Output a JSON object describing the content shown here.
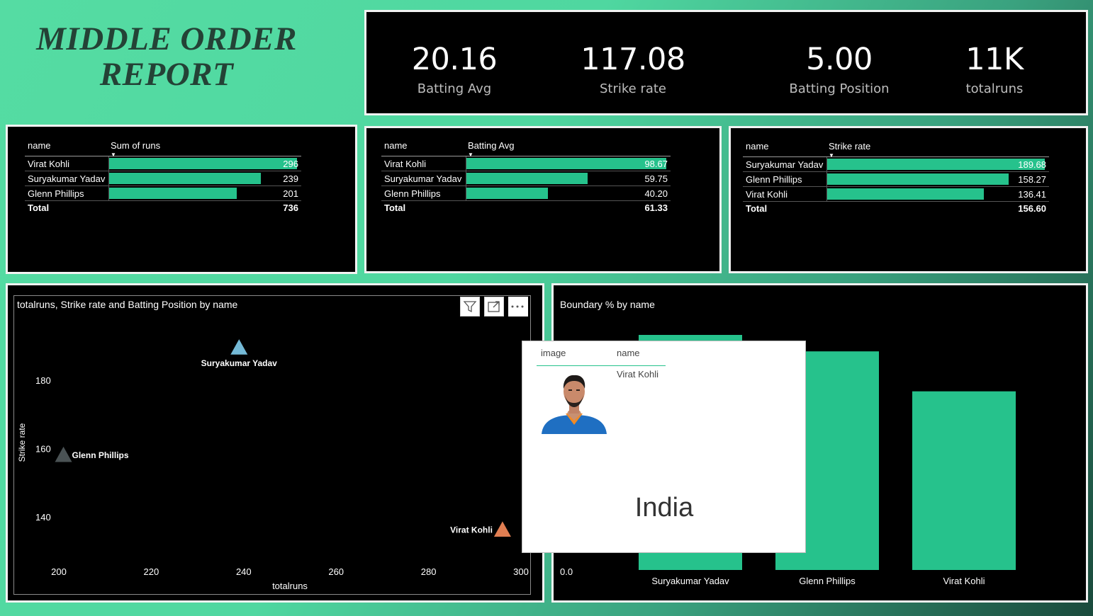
{
  "report_title": "MIDDLE ORDER REPORT",
  "kpis": [
    {
      "value": "20.16",
      "label": "Batting Avg"
    },
    {
      "value": "117.08",
      "label": "Strike rate"
    },
    {
      "value": "5.00",
      "label": "Batting Position"
    },
    {
      "value": "11K",
      "label": "totalruns"
    }
  ],
  "table_runs": {
    "col_name": "name",
    "col_value": "Sum of runs",
    "rows": [
      {
        "name": "Virat Kohli",
        "value": "296",
        "fraction": 1.0
      },
      {
        "name": "Suryakumar Yadav",
        "value": "239",
        "fraction": 0.807
      },
      {
        "name": "Glenn Phillips",
        "value": "201",
        "fraction": 0.679
      }
    ],
    "total_label": "Total",
    "total_value": "736"
  },
  "table_avg": {
    "col_name": "name",
    "col_value": "Batting Avg",
    "rows": [
      {
        "name": "Virat Kohli",
        "value": "98.67",
        "fraction": 1.0
      },
      {
        "name": "Suryakumar Yadav",
        "value": "59.75",
        "fraction": 0.606
      },
      {
        "name": "Glenn Phillips",
        "value": "40.20",
        "fraction": 0.407
      }
    ],
    "total_label": "Total",
    "total_value": "61.33"
  },
  "table_sr": {
    "col_name": "name",
    "col_value": "Strike rate",
    "rows": [
      {
        "name": "Suryakumar Yadav",
        "value": "189.68",
        "fraction": 1.0
      },
      {
        "name": "Glenn Phillips",
        "value": "158.27",
        "fraction": 0.834
      },
      {
        "name": "Virat Kohli",
        "value": "136.41",
        "fraction": 0.719
      }
    ],
    "total_label": "Total",
    "total_value": "156.60"
  },
  "scatter": {
    "title": "totalruns, Strike rate and Batting Position by name",
    "xlabel": "totalruns",
    "ylabel": "Strike rate",
    "toolbar": [
      "filter-icon",
      "focus-mode-icon",
      "more-options-icon"
    ]
  },
  "boundary": {
    "title": "Boundary % by name",
    "zero_label": "0.0"
  },
  "tooltip": {
    "col_image": "image",
    "col_name": "name",
    "name": "Virat Kohli",
    "country": "India"
  },
  "colors": {
    "accent": "#26c28c",
    "suryakumar": "#74b9d6",
    "glenn": "#4a5254",
    "virat": "#e07e52"
  },
  "chart_data": [
    {
      "type": "scatter",
      "title": "totalruns, Strike rate and Batting Position by name",
      "xlabel": "totalruns",
      "ylabel": "Strike rate",
      "xlim": [
        200,
        300
      ],
      "ylim": [
        128,
        198
      ],
      "xticks": [
        200,
        220,
        240,
        260,
        280,
        300
      ],
      "yticks": [
        140,
        160,
        180
      ],
      "points": [
        {
          "name": "Suryakumar Yadav",
          "x": 239,
          "y": 189.68
        },
        {
          "name": "Glenn Phillips",
          "x": 201,
          "y": 158.27
        },
        {
          "name": "Virat Kohli",
          "x": 296,
          "y": 136.41
        }
      ]
    },
    {
      "type": "bar",
      "title": "Boundary % by name",
      "categories": [
        "Suryakumar Yadav",
        "Glenn Phillips",
        "Virat Kohli"
      ],
      "values": [
        1.0,
        0.93,
        0.76
      ],
      "ylim": [
        0,
        1.0
      ]
    }
  ]
}
